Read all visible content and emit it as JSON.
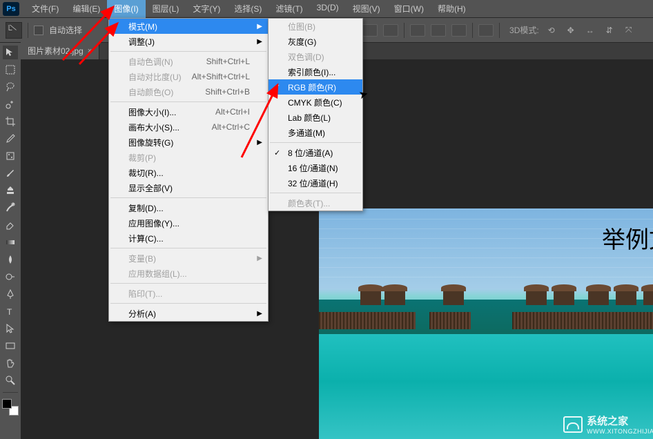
{
  "app": {
    "logo": "Ps"
  },
  "menubar": [
    {
      "label": "文件(F)"
    },
    {
      "label": "编辑(E)"
    },
    {
      "label": "图像(I)",
      "active": true
    },
    {
      "label": "图层(L)"
    },
    {
      "label": "文字(Y)"
    },
    {
      "label": "选择(S)"
    },
    {
      "label": "滤镜(T)"
    },
    {
      "label": "3D(D)"
    },
    {
      "label": "视图(V)"
    },
    {
      "label": "窗口(W)"
    },
    {
      "label": "帮助(H)"
    }
  ],
  "optbar": {
    "auto_select": "自动选择",
    "mode3d": "3D模式:"
  },
  "tab": {
    "name": "图片素材02.jpg",
    "close": "×"
  },
  "menu1": [
    {
      "label": "模式(M)",
      "arrow": true,
      "hl": true
    },
    {
      "label": "调整(J)",
      "arrow": true,
      "indent": false
    },
    {
      "sep": true
    },
    {
      "label": "自动色调(N)",
      "sc": "Shift+Ctrl+L",
      "dis": true
    },
    {
      "label": "自动对比度(U)",
      "sc": "Alt+Shift+Ctrl+L",
      "dis": true
    },
    {
      "label": "自动颜色(O)",
      "sc": "Shift+Ctrl+B",
      "dis": true
    },
    {
      "sep": true
    },
    {
      "label": "图像大小(I)...",
      "sc": "Alt+Ctrl+I"
    },
    {
      "label": "画布大小(S)...",
      "sc": "Alt+Ctrl+C"
    },
    {
      "label": "图像旋转(G)",
      "arrow": true
    },
    {
      "label": "裁剪(P)",
      "dis": true
    },
    {
      "label": "裁切(R)..."
    },
    {
      "label": "显示全部(V)"
    },
    {
      "sep": true
    },
    {
      "label": "复制(D)..."
    },
    {
      "label": "应用图像(Y)..."
    },
    {
      "label": "计算(C)..."
    },
    {
      "sep": true
    },
    {
      "label": "变量(B)",
      "arrow": true,
      "dis": true
    },
    {
      "label": "应用数据组(L)...",
      "dis": true
    },
    {
      "sep": true
    },
    {
      "label": "陷印(T)...",
      "dis": true
    },
    {
      "sep": true
    },
    {
      "label": "分析(A)",
      "arrow": true
    }
  ],
  "menu2": [
    {
      "label": "位图(B)",
      "dis": true
    },
    {
      "label": "灰度(G)"
    },
    {
      "label": "双色调(D)",
      "dis": true
    },
    {
      "label": "索引颜色(I)..."
    },
    {
      "label": "RGB 颜色(R)",
      "hl": true,
      "check": true
    },
    {
      "label": "CMYK 颜色(C)"
    },
    {
      "label": "Lab 颜色(L)"
    },
    {
      "label": "多通道(M)"
    },
    {
      "sep": true
    },
    {
      "label": "8 位/通道(A)",
      "check": true
    },
    {
      "label": "16 位/通道(N)"
    },
    {
      "label": "32 位/通道(H)"
    },
    {
      "sep": true
    },
    {
      "label": "颜色表(T)...",
      "dis": true
    }
  ],
  "canvas": {
    "text": "举例文",
    "watermark_title": "系统之家",
    "watermark_url": "WWW.XITONGZHIJIA.NET"
  }
}
